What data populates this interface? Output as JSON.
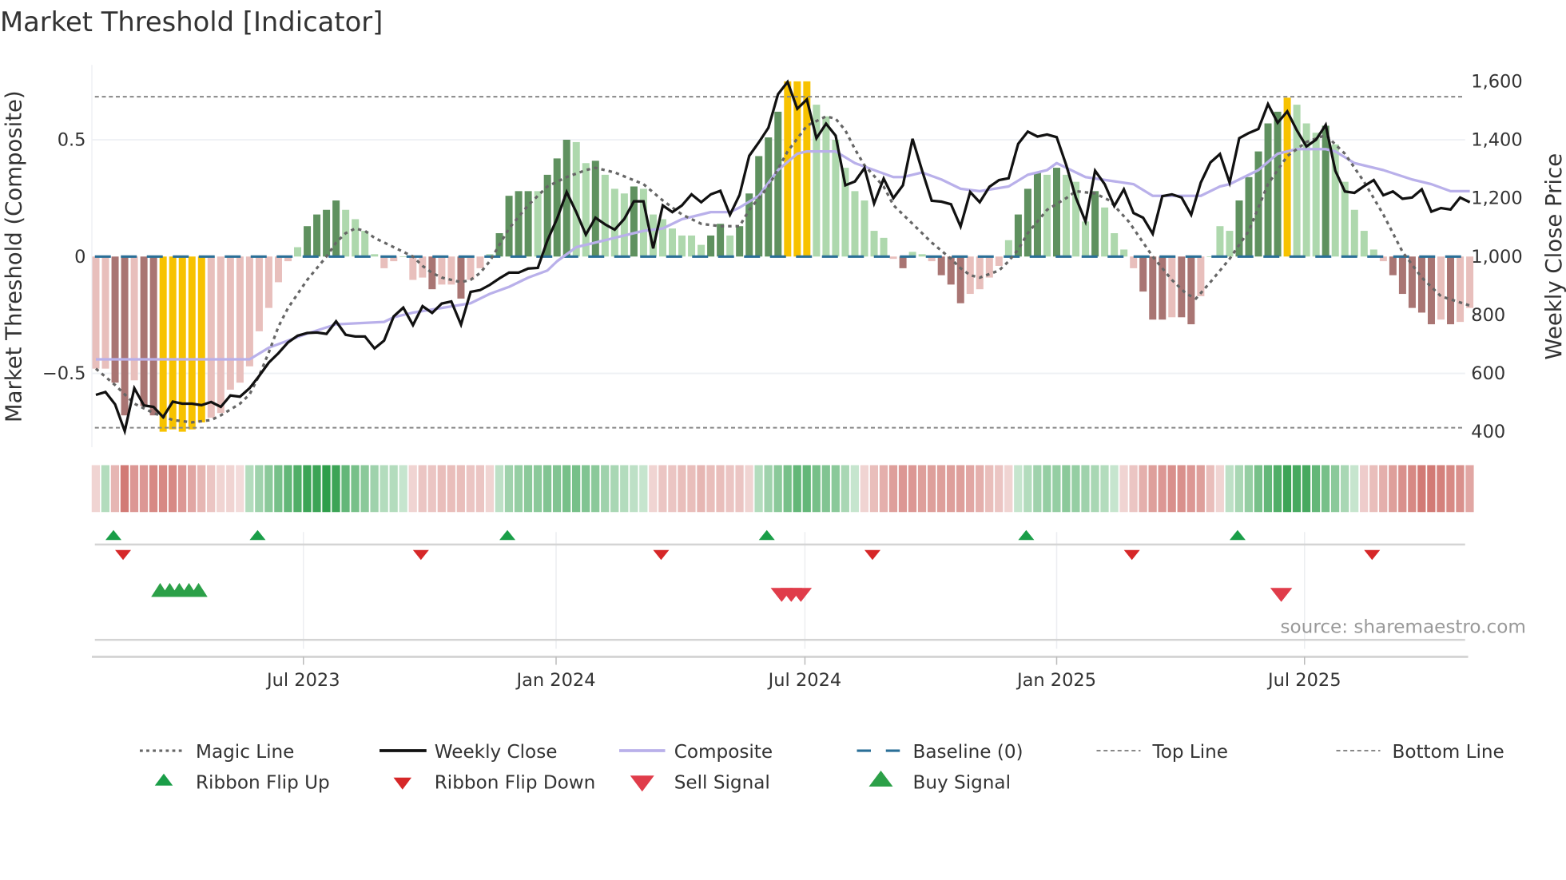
{
  "title": "Market Threshold [Indicator]",
  "source": "source: sharemaestro.com",
  "colors": {
    "bar_strong_up": "#5f915f",
    "bar_weak_up": "#aed8ad",
    "bar_strong_down": "#a97573",
    "bar_weak_down": "#e8bfbc",
    "bar_extreme": "#f7c200",
    "weekly_close": "#111111",
    "composite": "#b9b0ea",
    "magic": "#666666",
    "baseline": "#2a6f97",
    "ribbon_up": "#2e9e4a",
    "ribbon_down": "#c9605a",
    "flip_up": "#1a9e48",
    "flip_down": "#d62728",
    "buy": "#2ca048",
    "sell": "#e03c4a"
  },
  "chart_data": {
    "type": "bar+line",
    "title": "Market Threshold [Indicator]",
    "ylabel_left": "Market Threshold (Composite)",
    "ylabel_right": "Weekly Close Price",
    "ylim_left": [
      -0.75,
      0.75
    ],
    "ylim_right": [
      400,
      1600
    ],
    "left_ticks": [
      {
        "v": 0.5,
        "label": "0.5"
      },
      {
        "v": 0,
        "label": "0"
      },
      {
        "v": -0.5,
        "label": "−0.5"
      }
    ],
    "right_ticks": [
      {
        "v": 1600,
        "label": "1,600"
      },
      {
        "v": 1400,
        "label": "1,400"
      },
      {
        "v": 1200,
        "label": "1,200"
      },
      {
        "v": 1000,
        "label": "1,000"
      },
      {
        "v": 800,
        "label": "800"
      },
      {
        "v": 600,
        "label": "600"
      },
      {
        "v": 400,
        "label": "400"
      }
    ],
    "x_ticks": [
      {
        "week": 21.6,
        "label": "Jul 2023"
      },
      {
        "week": 47.9,
        "label": "Jan 2024"
      },
      {
        "week": 73.8,
        "label": "Jul 2024"
      },
      {
        "week": 100.0,
        "label": "Jan 2025"
      },
      {
        "week": 125.8,
        "label": "Jul 2025"
      }
    ],
    "top_line": 0.684,
    "bottom_line": -0.733,
    "baseline": 0,
    "weeks": 144,
    "composite_bars": [
      -0.48,
      -0.48,
      -0.54,
      -0.68,
      -0.53,
      -0.64,
      -0.68,
      -0.75,
      -0.74,
      -0.75,
      -0.74,
      -0.71,
      -0.69,
      -0.67,
      -0.57,
      -0.54,
      -0.47,
      -0.32,
      -0.22,
      -0.11,
      -0.02,
      0.04,
      0.13,
      0.18,
      0.2,
      0.24,
      0.2,
      0.16,
      0.11,
      0.01,
      -0.05,
      -0.02,
      0,
      -0.1,
      -0.09,
      -0.14,
      -0.12,
      -0.12,
      -0.18,
      -0.1,
      -0.05,
      0.01,
      0.1,
      0.26,
      0.28,
      0.28,
      0.28,
      0.35,
      0.42,
      0.5,
      0.49,
      0.4,
      0.41,
      0.35,
      0.29,
      0.27,
      0.3,
      0.29,
      0.18,
      0.16,
      0.12,
      0.09,
      0.09,
      0.05,
      0.09,
      0.14,
      0.09,
      0.13,
      0.27,
      0.43,
      0.51,
      0.62,
      0.75,
      0.75,
      0.75,
      0.65,
      0.6,
      0.5,
      0.38,
      0.28,
      0.24,
      0.11,
      0.08,
      -0.01,
      -0.05,
      0.02,
      0.01,
      -0.02,
      -0.08,
      -0.12,
      -0.2,
      -0.16,
      -0.14,
      -0.09,
      -0.04,
      0.07,
      0.18,
      0.29,
      0.36,
      0.35,
      0.38,
      0.35,
      0.32,
      0.15,
      0.28,
      0.21,
      0.1,
      0.03,
      -0.05,
      -0.15,
      -0.27,
      -0.27,
      -0.26,
      -0.26,
      -0.29,
      -0.17,
      0,
      0.13,
      0.11,
      0.24,
      0.34,
      0.45,
      0.57,
      0.62,
      0.68,
      0.65,
      0.57,
      0.53,
      0.56,
      0.48,
      0.32,
      0.2,
      0.11,
      0.03,
      -0.02,
      -0.08,
      -0.16,
      -0.22,
      -0.24,
      -0.29,
      -0.27,
      -0.29,
      -0.28,
      -0.22
    ],
    "bar_kinds": [
      "l",
      "l",
      "d",
      "d",
      "l",
      "d",
      "d",
      "y",
      "y",
      "y",
      "y",
      "y",
      "l",
      "l",
      "l",
      "l",
      "l",
      "l",
      "l",
      "l",
      "l",
      "l",
      "d",
      "d",
      "d",
      "d",
      "l",
      "l",
      "l",
      "l",
      "l",
      "l",
      "l",
      "l",
      "l",
      "d",
      "l",
      "l",
      "d",
      "l",
      "l",
      "l",
      "d",
      "d",
      "d",
      "d",
      "l",
      "d",
      "d",
      "d",
      "l",
      "l",
      "d",
      "l",
      "l",
      "l",
      "d",
      "l",
      "l",
      "l",
      "l",
      "l",
      "l",
      "l",
      "d",
      "d",
      "l",
      "d",
      "d",
      "d",
      "d",
      "d",
      "y",
      "y",
      "y",
      "l",
      "l",
      "l",
      "l",
      "l",
      "l",
      "l",
      "l",
      "l",
      "d",
      "l",
      "l",
      "l",
      "d",
      "d",
      "d",
      "l",
      "l",
      "l",
      "l",
      "l",
      "d",
      "d",
      "d",
      "l",
      "d",
      "l",
      "l",
      "l",
      "d",
      "l",
      "l",
      "l",
      "l",
      "d",
      "d",
      "d",
      "l",
      "d",
      "d",
      "l",
      "l",
      "l",
      "l",
      "d",
      "d",
      "d",
      "d",
      "d",
      "y",
      "l",
      "l",
      "l",
      "d",
      "l",
      "l",
      "l",
      "l",
      "l",
      "l",
      "d",
      "d",
      "d",
      "d",
      "d",
      "l",
      "d",
      "l",
      "l"
    ],
    "weekly_close": [
      526,
      536,
      494,
      402,
      549,
      490,
      485,
      450,
      503,
      496,
      496,
      491,
      502,
      485,
      524,
      520,
      549,
      591,
      637,
      669,
      706,
      729,
      738,
      740,
      735,
      778,
      732,
      726,
      726,
      685,
      712,
      795,
      825,
      765,
      830,
      807,
      839,
      846,
      767,
      879,
      885,
      903,
      925,
      945,
      945,
      959,
      961,
      1055,
      1130,
      1221,
      1152,
      1075,
      1133,
      1110,
      1092,
      1129,
      1189,
      1189,
      1028,
      1175,
      1152,
      1175,
      1213,
      1186,
      1213,
      1225,
      1143,
      1211,
      1345,
      1391,
      1441,
      1556,
      1598,
      1506,
      1538,
      1405,
      1455,
      1414,
      1244,
      1257,
      1303,
      1182,
      1267,
      1200,
      1244,
      1403,
      1294,
      1191,
      1188,
      1179,
      1103,
      1221,
      1186,
      1239,
      1262,
      1268,
      1386,
      1428,
      1411,
      1418,
      1409,
      1313,
      1202,
      1120,
      1294,
      1248,
      1173,
      1230,
      1149,
      1133,
      1078,
      1207,
      1213,
      1202,
      1143,
      1253,
      1322,
      1351,
      1253,
      1405,
      1423,
      1437,
      1522,
      1458,
      1497,
      1432,
      1377,
      1400,
      1451,
      1294,
      1223,
      1218,
      1241,
      1262,
      1210,
      1223,
      1198,
      1202,
      1230,
      1154,
      1166,
      1161,
      1202,
      1186
    ],
    "composite_line": [
      [
        0,
        -0.44
      ],
      [
        16,
        -0.44
      ],
      [
        18,
        -0.39
      ],
      [
        20,
        -0.36
      ],
      [
        22,
        -0.33
      ],
      [
        25,
        -0.29
      ],
      [
        30,
        -0.28
      ],
      [
        31,
        -0.26
      ],
      [
        33,
        -0.24
      ],
      [
        36,
        -0.22
      ],
      [
        39,
        -0.2
      ],
      [
        41,
        -0.16
      ],
      [
        43,
        -0.13
      ],
      [
        45,
        -0.09
      ],
      [
        47,
        -0.06
      ],
      [
        48,
        -0.02
      ],
      [
        49,
        0.01
      ],
      [
        50,
        0.04
      ],
      [
        52,
        0.06
      ],
      [
        55,
        0.09
      ],
      [
        57,
        0.11
      ],
      [
        59,
        0.12
      ],
      [
        61,
        0.16
      ],
      [
        64,
        0.19
      ],
      [
        66,
        0.19
      ],
      [
        67,
        0.21
      ],
      [
        69,
        0.26
      ],
      [
        71,
        0.37
      ],
      [
        73,
        0.44
      ],
      [
        74,
        0.45
      ],
      [
        77,
        0.45
      ],
      [
        79,
        0.4
      ],
      [
        81,
        0.37
      ],
      [
        83,
        0.34
      ],
      [
        84,
        0.34
      ],
      [
        86,
        0.36
      ],
      [
        88,
        0.33
      ],
      [
        90,
        0.29
      ],
      [
        92,
        0.28
      ],
      [
        95,
        0.3
      ],
      [
        97,
        0.35
      ],
      [
        99,
        0.37
      ],
      [
        100,
        0.4
      ],
      [
        103,
        0.34
      ],
      [
        108,
        0.31
      ],
      [
        110,
        0.26
      ],
      [
        115,
        0.26
      ],
      [
        117,
        0.3
      ],
      [
        118,
        0.31
      ],
      [
        121,
        0.37
      ],
      [
        123,
        0.44
      ],
      [
        125,
        0.46
      ],
      [
        128,
        0.46
      ],
      [
        129,
        0.45
      ],
      [
        131,
        0.4
      ],
      [
        134,
        0.37
      ],
      [
        137,
        0.33
      ],
      [
        139,
        0.31
      ],
      [
        141,
        0.28
      ],
      [
        143,
        0.28
      ]
    ],
    "magic_line": [
      [
        0,
        -0.48
      ],
      [
        2,
        -0.55
      ],
      [
        4,
        -0.63
      ],
      [
        6,
        -0.67
      ],
      [
        8,
        -0.7
      ],
      [
        10,
        -0.71
      ],
      [
        12,
        -0.7
      ],
      [
        13,
        -0.68
      ],
      [
        15,
        -0.63
      ],
      [
        16,
        -0.59
      ],
      [
        17,
        -0.51
      ],
      [
        18,
        -0.41
      ],
      [
        19,
        -0.3
      ],
      [
        20,
        -0.22
      ],
      [
        22,
        -0.1
      ],
      [
        24,
        0
      ],
      [
        25,
        0.06
      ],
      [
        26,
        0.1
      ],
      [
        27,
        0.12
      ],
      [
        28,
        0.11
      ],
      [
        29,
        0.08
      ],
      [
        31,
        0.04
      ],
      [
        32,
        0.02
      ],
      [
        33,
        0
      ],
      [
        34,
        -0.04
      ],
      [
        35,
        -0.07
      ],
      [
        36,
        -0.09
      ],
      [
        38,
        -0.11
      ],
      [
        39,
        -0.1
      ],
      [
        40,
        -0.07
      ],
      [
        41,
        -0.02
      ],
      [
        42,
        0.05
      ],
      [
        43,
        0.12
      ],
      [
        44,
        0.17
      ],
      [
        45,
        0.22
      ],
      [
        46,
        0.26
      ],
      [
        47,
        0.3
      ],
      [
        49,
        0.34
      ],
      [
        51,
        0.37
      ],
      [
        52,
        0.38
      ],
      [
        54,
        0.36
      ],
      [
        57,
        0.31
      ],
      [
        59,
        0.24
      ],
      [
        61,
        0.18
      ],
      [
        63,
        0.14
      ],
      [
        65,
        0.13
      ],
      [
        67,
        0.13
      ],
      [
        68,
        0.2
      ],
      [
        70,
        0.3
      ],
      [
        72,
        0.45
      ],
      [
        74,
        0.56
      ],
      [
        76,
        0.6
      ],
      [
        77,
        0.59
      ],
      [
        78,
        0.54
      ],
      [
        79,
        0.46
      ],
      [
        80,
        0.39
      ],
      [
        82,
        0.3
      ],
      [
        83,
        0.22
      ],
      [
        85,
        0.14
      ],
      [
        87,
        0.06
      ],
      [
        89,
        -0.01
      ],
      [
        90,
        -0.05
      ],
      [
        91,
        -0.08
      ],
      [
        92,
        -0.09
      ],
      [
        94,
        -0.06
      ],
      [
        95,
        -0.02
      ],
      [
        96,
        0.03
      ],
      [
        97,
        0.1
      ],
      [
        99,
        0.2
      ],
      [
        101,
        0.25
      ],
      [
        102,
        0.28
      ],
      [
        104,
        0.27
      ],
      [
        105.5,
        0.24
      ],
      [
        107.5,
        0.15
      ],
      [
        110,
        0
      ],
      [
        112,
        -0.1
      ],
      [
        113.5,
        -0.16
      ],
      [
        114.5,
        -0.18
      ],
      [
        116,
        -0.11
      ],
      [
        118,
        -0.01
      ],
      [
        120,
        0.11
      ],
      [
        122,
        0.31
      ],
      [
        124,
        0.43
      ],
      [
        126,
        0.49
      ],
      [
        128,
        0.52
      ],
      [
        130,
        0.44
      ],
      [
        132,
        0.32
      ],
      [
        134,
        0.18
      ],
      [
        136,
        0.02
      ],
      [
        138,
        -0.09
      ],
      [
        140,
        -0.17
      ],
      [
        143,
        -0.21
      ]
    ],
    "ribbon": [
      -0.2,
      0.3,
      -0.4,
      -0.8,
      -0.6,
      -0.6,
      -0.7,
      -0.7,
      -0.7,
      -0.6,
      -0.5,
      -0.4,
      -0.3,
      -0.2,
      -0.2,
      -0.15,
      0.3,
      0.4,
      0.5,
      0.6,
      0.7,
      0.8,
      0.9,
      0.9,
      1.0,
      0.9,
      0.7,
      0.6,
      0.5,
      0.4,
      0.3,
      0.3,
      0.2,
      -0.2,
      -0.3,
      -0.3,
      -0.35,
      -0.35,
      -0.35,
      -0.3,
      -0.3,
      -0.2,
      0.25,
      0.4,
      0.45,
      0.5,
      0.5,
      0.55,
      0.55,
      0.6,
      0.6,
      0.55,
      0.5,
      0.4,
      0.35,
      0.3,
      0.25,
      0.2,
      -0.2,
      -0.3,
      -0.3,
      -0.35,
      -0.35,
      -0.4,
      -0.35,
      -0.35,
      -0.3,
      -0.3,
      -0.2,
      0.3,
      0.4,
      0.5,
      0.6,
      0.7,
      0.7,
      0.6,
      0.55,
      0.5,
      0.35,
      0.2,
      -0.2,
      -0.35,
      -0.45,
      -0.55,
      -0.6,
      -0.6,
      -0.55,
      -0.55,
      -0.55,
      -0.55,
      -0.55,
      -0.5,
      -0.45,
      -0.35,
      -0.3,
      -0.2,
      0.2,
      0.3,
      0.4,
      0.45,
      0.45,
      0.5,
      0.45,
      0.4,
      0.35,
      0.3,
      0.2,
      -0.2,
      -0.3,
      -0.45,
      -0.55,
      -0.6,
      -0.65,
      -0.65,
      -0.6,
      -0.55,
      -0.35,
      -0.2,
      0.25,
      0.35,
      0.45,
      0.6,
      0.7,
      0.8,
      0.9,
      0.85,
      0.85,
      0.7,
      0.6,
      0.5,
      0.35,
      0.2,
      -0.25,
      -0.35,
      -0.45,
      -0.55,
      -0.65,
      -0.7,
      -0.8,
      -0.8,
      -0.75,
      -0.7,
      -0.65,
      -0.5
    ],
    "ribbon_flip_up_weeks": [
      1,
      16,
      42,
      69,
      96,
      118
    ],
    "ribbon_flip_down_weeks": [
      2,
      33,
      58,
      80,
      107,
      132
    ],
    "buy_signal_weeks": [
      7,
      8,
      9,
      10,
      11
    ],
    "sell_signal_weeks": [
      72,
      73,
      74,
      124
    ],
    "legend": [
      {
        "key": "magic",
        "label": "Magic Line"
      },
      {
        "key": "close",
        "label": "Weekly Close"
      },
      {
        "key": "composite",
        "label": "Composite"
      },
      {
        "key": "baseline",
        "label": "Baseline (0)"
      },
      {
        "key": "top",
        "label": "Top Line"
      },
      {
        "key": "bottom",
        "label": "Bottom Line"
      },
      {
        "key": "flipup",
        "label": "Ribbon Flip Up"
      },
      {
        "key": "flipdown",
        "label": "Ribbon Flip Down"
      },
      {
        "key": "sell",
        "label": "Sell Signal"
      },
      {
        "key": "buy",
        "label": "Buy Signal"
      }
    ],
    "legend_placement": "bottom"
  }
}
